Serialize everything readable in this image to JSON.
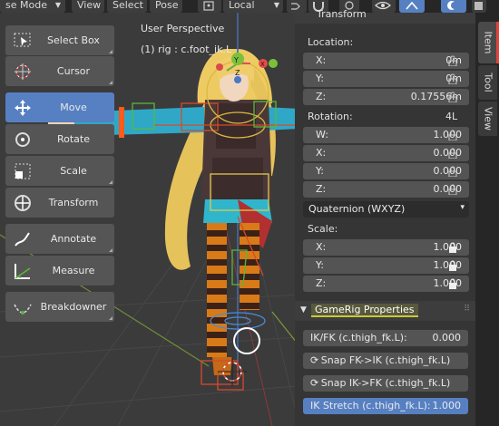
{
  "header": {
    "mode_label": "se Mode",
    "menus": [
      "View",
      "Select",
      "Pose"
    ],
    "orientation_label": "Local"
  },
  "viewport": {
    "title": "User Perspective",
    "subtitle": "(1) rig : c.foot_ik.L"
  },
  "toolbar": {
    "select_box": "Select Box",
    "cursor": "Cursor",
    "move": "Move",
    "rotate": "Rotate",
    "scale": "Scale",
    "transform": "Transform",
    "annotate": "Annotate",
    "measure": "Measure",
    "breakdowner": "Breakdowner"
  },
  "panel": {
    "section_title": "Transform",
    "location": {
      "label": "Location:",
      "x": {
        "key": "X:",
        "value": "0m"
      },
      "y": {
        "key": "Y:",
        "value": "0m"
      },
      "z": {
        "key": "Z:",
        "value": "0.17556m"
      }
    },
    "rotation": {
      "label": "Rotation:",
      "mode_tag": "4L",
      "w": {
        "key": "W:",
        "value": "1.000"
      },
      "x": {
        "key": "X:",
        "value": "0.000"
      },
      "y": {
        "key": "Y:",
        "value": "0.000"
      },
      "z": {
        "key": "Z:",
        "value": "0.000"
      },
      "mode": "Quaternion (WXYZ)"
    },
    "scale": {
      "label": "Scale:",
      "x": {
        "key": "X:",
        "value": "1.000"
      },
      "y": {
        "key": "Y:",
        "value": "1.000"
      },
      "z": {
        "key": "Z:",
        "value": "1.000"
      }
    },
    "gamerig": {
      "title": "GameRig Properties",
      "ikfk_label": "IK/FK (c.thigh_fk.L):",
      "ikfk_value": "0.000",
      "snap_fk_ik": "Snap FK->IK (c.thigh_fk.L)",
      "snap_ik_fk": "Snap IK->FK (c.thigh_fk.L)",
      "ik_stretch_label": "IK Stretch (c.thigh_fk.L):",
      "ik_stretch_value": "1.000"
    }
  },
  "tabs": [
    "Item",
    "Tool",
    "View"
  ],
  "colors": {
    "accent_blue": "#5680c2",
    "gamerig_highlight": "#c9c93a",
    "tab_indicator": "#e0443a"
  }
}
